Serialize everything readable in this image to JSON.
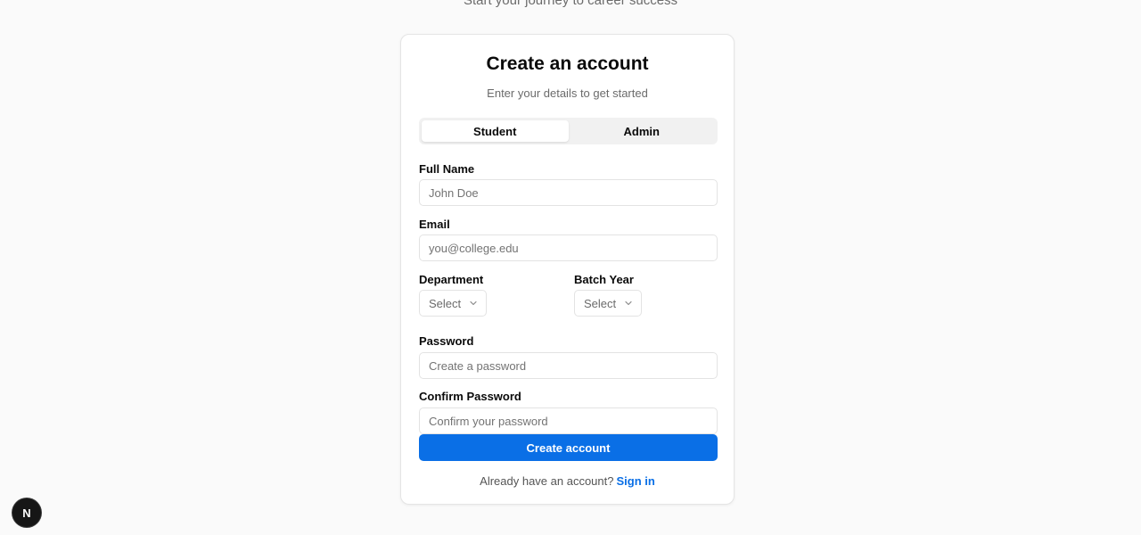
{
  "header": {
    "tagline": "Start your journey to career success"
  },
  "card": {
    "title": "Create an account",
    "subtitle": "Enter your details to get started"
  },
  "role_tabs": [
    {
      "label": "Student",
      "active": true
    },
    {
      "label": "Admin",
      "active": false
    }
  ],
  "form": {
    "full_name": {
      "label": "Full Name",
      "placeholder": "John Doe",
      "value": ""
    },
    "email": {
      "label": "Email",
      "placeholder": "you@college.edu",
      "value": ""
    },
    "department": {
      "label": "Department",
      "selected": "Select"
    },
    "batch_year": {
      "label": "Batch Year",
      "selected": "Select"
    },
    "password": {
      "label": "Password",
      "placeholder": "Create a password",
      "value": ""
    },
    "confirm_password": {
      "label": "Confirm Password",
      "placeholder": "Confirm your password",
      "value": ""
    },
    "submit_label": "Create account"
  },
  "footer": {
    "prompt": "Already have an account?",
    "link_label": "Sign in"
  },
  "dev_badge": {
    "letter": "N"
  },
  "colors": {
    "accent": "#0a6fe6",
    "background": "#fafafa"
  }
}
